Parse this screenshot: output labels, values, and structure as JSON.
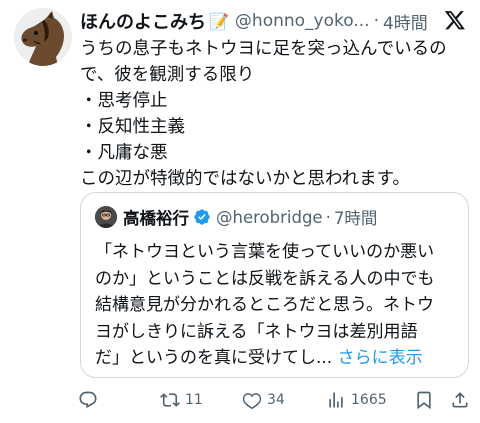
{
  "author": {
    "name": "ほんのよこみち",
    "memo_emoji": "📝",
    "handle": "@honno_yoko...",
    "separator": "·",
    "time": "4時間",
    "avatar_icon": "horse-avatar"
  },
  "platform_icon": "x-logo-icon",
  "post": {
    "lines": [
      "うちの息子もネトウヨに足を突っ込んでいるの",
      "で、彼を観測する限り",
      "・思考停止",
      "・反知性主義",
      "・凡庸な悪",
      "この辺が特徴的ではないかと思われます。"
    ]
  },
  "quote": {
    "name": "高橋裕行",
    "verified_icon": "verified-badge-icon",
    "handle": "@herobridge",
    "separator": "·",
    "time": "7時間",
    "lines": [
      "「ネトウヨという言葉を使っていいのか悪い",
      "のか」ということは反戦を訴える人の中でも",
      "結構意見が分かれるところだと思う。ネトウ",
      "ヨがしきりに訴える「ネトウヨは差別用語",
      "だ」というのを真に受けてし..."
    ],
    "more_label": "さらに表示"
  },
  "actions": {
    "reply": {
      "icon": "reply-icon",
      "count": ""
    },
    "retweet": {
      "icon": "retweet-icon",
      "count": "11"
    },
    "like": {
      "icon": "heart-icon",
      "count": "34"
    },
    "views": {
      "icon": "views-chart-icon",
      "count": "1665"
    },
    "bookmark": {
      "icon": "bookmark-icon",
      "count": ""
    },
    "share": {
      "icon": "share-icon",
      "count": ""
    }
  },
  "colors": {
    "text": "#0f1419",
    "secondary": "#536471",
    "link": "#1d9bf0",
    "border": "#cfd9de"
  }
}
